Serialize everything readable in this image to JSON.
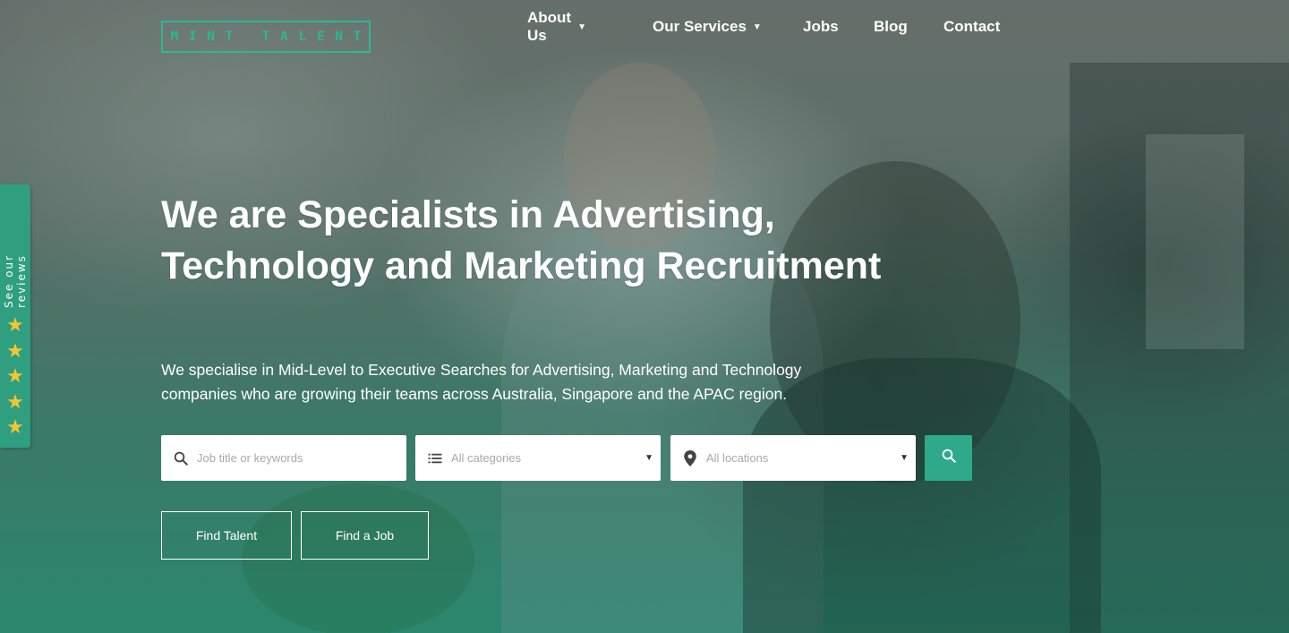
{
  "header": {
    "logo_text": "MINT TALENT",
    "nav": [
      {
        "label": "About Us",
        "has_dropdown": true
      },
      {
        "label": "Our Services",
        "has_dropdown": true
      },
      {
        "label": "Jobs",
        "has_dropdown": false
      },
      {
        "label": "Blog",
        "has_dropdown": false
      },
      {
        "label": "Contact",
        "has_dropdown": false
      }
    ]
  },
  "reviews_tab": {
    "label": "See our reviews",
    "stars": 5
  },
  "hero": {
    "headline": "We are Specialists in Advertising, Technology and Marketing Recruitment",
    "subtext": "We specialise in Mid-Level to Executive Searches for Advertising, Marketing and Technology companies who are growing their teams across Australia, Singapore and the APAC region."
  },
  "search": {
    "keywords_placeholder": "Job title or keywords",
    "categories_selected": "All categories",
    "locations_selected": "All locations"
  },
  "buttons": {
    "find_talent": "Find Talent",
    "find_job": "Find a Job"
  },
  "colors": {
    "accent": "#2eaa8a",
    "logo": "#2bb894",
    "star": "#f4c531"
  },
  "icons": {
    "search": "search-icon",
    "list": "list-icon",
    "location": "location-pin-icon",
    "caret": "caret-down-icon",
    "star": "star-icon"
  }
}
